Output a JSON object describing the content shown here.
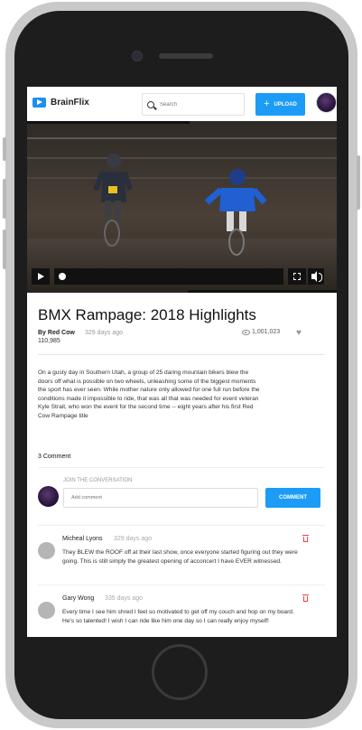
{
  "header": {
    "logo_text": "BrainFlix",
    "search_placeholder": "Search",
    "upload_label": "UPLOAD",
    "upload_icon": "+"
  },
  "video": {
    "progress": 0.0
  },
  "details": {
    "title": "BMX Rampage: 2018 Highlights",
    "author": "By Red Cow",
    "age": "329 days ago",
    "subscribers": "110,985",
    "views": "1,001,023",
    "description": "On a gusty day in Southern Utah, a group of 25 daring mountain bikers blew the doors off what is possible on two wheels, unleashing some of the biggest moments the sport has ever seen. While mother nature only allowed for one full run before the conditions made it impossible to ride, that was all that was needed for event veteran Kyle Strait, who won the event for the second time -- eight years after his first Red Cow Rampage title"
  },
  "comments": {
    "count_label": "3 Comment",
    "join_label": "JOIN THE CONVERSATION",
    "input_placeholder": "Add comment",
    "submit_label": "COMMENT",
    "items": [
      {
        "name": "Micheal Lyons",
        "age": "329 days ago",
        "text": "They BLEW the ROOF off at their last show, once everyone started figuring out they were going. This is still simply the greatest opening of acconcert I have EVER witnessed."
      },
      {
        "name": "Gary Wong",
        "age": "335 days ago",
        "text": "Every time I see him shred I feel so motivated to get off my couch and hop on my board. He's so talented! I wish I can ride like him one day so I can really enjoy myself!"
      }
    ]
  },
  "colors": {
    "accent": "#1c9cf6",
    "delete": "#e04848"
  }
}
